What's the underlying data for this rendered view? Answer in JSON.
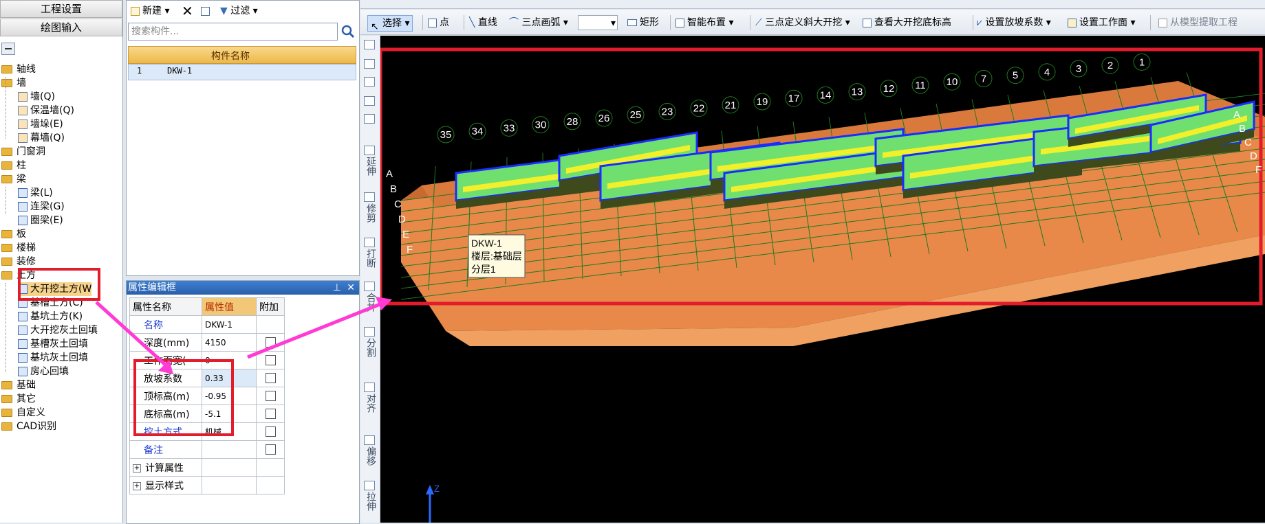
{
  "nav": {
    "project_settings": "工程设置",
    "drawing_input": "绘图输入",
    "tree": [
      {
        "label": "轴线",
        "type": "folder"
      },
      {
        "label": "墙",
        "type": "folder"
      },
      {
        "label": "墙(Q)",
        "type": "child"
      },
      {
        "label": "保温墙(Q)",
        "type": "child"
      },
      {
        "label": "墙垛(E)",
        "type": "child"
      },
      {
        "label": "幕墙(Q)",
        "type": "child"
      },
      {
        "label": "门窗洞",
        "type": "folder"
      },
      {
        "label": "柱",
        "type": "folder"
      },
      {
        "label": "梁",
        "type": "folder"
      },
      {
        "label": "梁(L)",
        "type": "child"
      },
      {
        "label": "连梁(G)",
        "type": "child"
      },
      {
        "label": "圈梁(E)",
        "type": "child"
      },
      {
        "label": "板",
        "type": "folder"
      },
      {
        "label": "楼梯",
        "type": "folder"
      },
      {
        "label": "装修",
        "type": "folder"
      },
      {
        "label": "土方",
        "type": "folder"
      },
      {
        "label": "大开挖土方(W",
        "type": "child"
      },
      {
        "label": "基槽土方(C)",
        "type": "child"
      },
      {
        "label": "基坑土方(K)",
        "type": "child"
      },
      {
        "label": "大开挖灰土回填",
        "type": "child"
      },
      {
        "label": "基槽灰土回填",
        "type": "child"
      },
      {
        "label": "基坑灰土回填",
        "type": "child"
      },
      {
        "label": "房心回填",
        "type": "child"
      },
      {
        "label": "基础",
        "type": "folder"
      },
      {
        "label": "其它",
        "type": "folder"
      },
      {
        "label": "自定义",
        "type": "folder"
      },
      {
        "label": "CAD识别",
        "type": "folder"
      }
    ]
  },
  "complist": {
    "new_label": "新建",
    "filter_label": "过滤",
    "search_placeholder": "搜索构件...",
    "column_header": "构件名称",
    "rows": [
      {
        "index": "1",
        "name": "DKW-1"
      }
    ]
  },
  "prop": {
    "title": "属性编辑框",
    "headers": {
      "name": "属性名称",
      "value": "属性值",
      "extra": "附加"
    },
    "rows": [
      {
        "name": "名称",
        "value": "DKW-1",
        "blue": true,
        "checkbox": false
      },
      {
        "name": "深度(mm)",
        "value": "4150",
        "blue": false,
        "checkbox": true
      },
      {
        "name": "工作面宽(",
        "value": "0",
        "blue": false,
        "checkbox": true
      },
      {
        "name": "放坡系数",
        "value": "0.33",
        "blue": false,
        "checkbox": true
      },
      {
        "name": "顶标高(m)",
        "value": "-0.95",
        "blue": false,
        "checkbox": true
      },
      {
        "name": "底标高(m)",
        "value": "-5.1",
        "blue": false,
        "checkbox": true
      },
      {
        "name": "挖土方式",
        "value": "机械",
        "blue": true,
        "checkbox": true
      },
      {
        "name": "备注",
        "value": "",
        "blue": true,
        "checkbox": true
      }
    ],
    "groups": [
      "计算属性",
      "显示样式"
    ]
  },
  "vtools": [
    "延伸",
    "修剪",
    "打断",
    "合并",
    "分割",
    "对齐",
    "偏移",
    "拉伸"
  ],
  "toolbar": {
    "select": "选择",
    "point": "点",
    "line": "直线",
    "arc3": "三点画弧",
    "rect": "矩形",
    "smart": "智能布置",
    "slope3": "三点定义斜大开挖",
    "view_bottom": "查看大开挖底标高",
    "set_slope": "设置放坡系数",
    "set_workface": "设置工作面",
    "extract": "从模型提取工程"
  },
  "viewport": {
    "tooltip_lines": [
      "DKW-1",
      "楼层:基础层",
      "分层1"
    ],
    "axis_numbers": [
      "35",
      "34",
      "33",
      "30",
      "28",
      "26",
      "25",
      "23",
      "22",
      "21",
      "19",
      "17",
      "14",
      "13",
      "12",
      "11",
      "10",
      "7",
      "5",
      "4",
      "3",
      "2",
      "1"
    ],
    "axis_letters_left": [
      "A",
      "B",
      "C",
      "D",
      "E",
      "F"
    ],
    "axis_letters_right": [
      "A",
      "B",
      "C",
      "D",
      "F"
    ],
    "z_label": "Z",
    "colors": {
      "earth": "#e8894a",
      "earth_dark": "#c96a30",
      "slab": "#6fe06f",
      "beam_yellow": "#f2f02a",
      "wall_blue": "#1a2cff",
      "grid": "#1e7a1e",
      "highlight": "#e31c2c",
      "arrow": "#ff3ad5"
    }
  }
}
